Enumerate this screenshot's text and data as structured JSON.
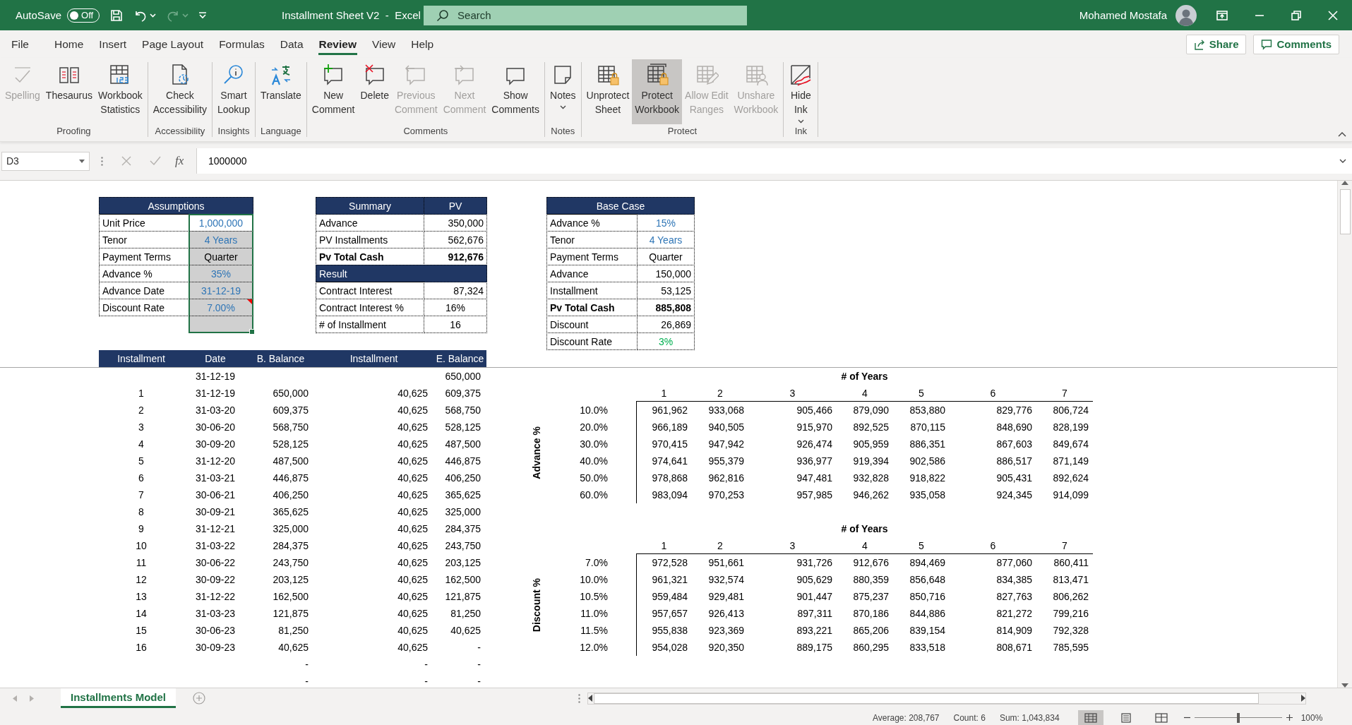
{
  "title_bar": {
    "autosave_label": "AutoSave",
    "autosave": {
      "on": false,
      "label": "Off"
    },
    "title": "Installment Sheet V2  -  Excel",
    "search": {
      "placeholder": "Search"
    },
    "user": "Mohamed Mostafa"
  },
  "tabs": [
    {
      "label": "File",
      "selected": false
    },
    {
      "label": "Home",
      "selected": false
    },
    {
      "label": "Insert",
      "selected": false
    },
    {
      "label": "Page Layout",
      "selected": false
    },
    {
      "label": "Formulas",
      "selected": false
    },
    {
      "label": "Data",
      "selected": false
    },
    {
      "label": "Review",
      "selected": true
    },
    {
      "label": "View",
      "selected": false
    },
    {
      "label": "Help",
      "selected": false
    }
  ],
  "share_button": "Share",
  "comments_button": "Comments",
  "ribbon": {
    "groups": [
      {
        "label": "Proofing",
        "buttons": [
          {
            "label": "Spelling",
            "disabled": true,
            "pressed": false,
            "dropdown": false
          },
          {
            "label": "Thesaurus",
            "disabled": false,
            "pressed": false,
            "dropdown": false
          },
          {
            "label": "Workbook\nStatistics",
            "disabled": false,
            "pressed": false,
            "dropdown": false
          }
        ]
      },
      {
        "label": "Accessibility",
        "buttons": [
          {
            "label": "Check\nAccessibility",
            "disabled": false,
            "pressed": false,
            "dropdown": false
          }
        ]
      },
      {
        "label": "Insights",
        "buttons": [
          {
            "label": "Smart\nLookup",
            "disabled": false,
            "pressed": false,
            "dropdown": false
          }
        ]
      },
      {
        "label": "Language",
        "buttons": [
          {
            "label": "Translate",
            "disabled": false,
            "pressed": false,
            "dropdown": false
          }
        ]
      },
      {
        "label": "Comments",
        "buttons": [
          {
            "label": "New\nComment",
            "disabled": false,
            "pressed": false,
            "dropdown": false
          },
          {
            "label": "Delete",
            "disabled": false,
            "pressed": false,
            "dropdown": false
          },
          {
            "label": "Previous\nComment",
            "disabled": true,
            "pressed": false,
            "dropdown": false
          },
          {
            "label": "Next\nComment",
            "disabled": true,
            "pressed": false,
            "dropdown": false
          },
          {
            "label": "Show\nComments",
            "disabled": false,
            "pressed": false,
            "dropdown": false
          }
        ]
      },
      {
        "label": "Notes",
        "buttons": [
          {
            "label": "Notes",
            "disabled": false,
            "pressed": false,
            "dropdown": true
          }
        ]
      },
      {
        "label": "Protect",
        "buttons": [
          {
            "label": "Unprotect\nSheet",
            "disabled": false,
            "pressed": false,
            "dropdown": false
          },
          {
            "label": "Protect\nWorkbook",
            "disabled": false,
            "pressed": true,
            "dropdown": false
          },
          {
            "label": "Allow Edit\nRanges",
            "disabled": true,
            "pressed": false,
            "dropdown": false
          },
          {
            "label": "Unshare\nWorkbook",
            "disabled": true,
            "pressed": false,
            "dropdown": false
          }
        ]
      },
      {
        "label": "Ink",
        "buttons": [
          {
            "label": "Hide\nInk",
            "disabled": false,
            "pressed": false,
            "dropdown": true
          }
        ]
      }
    ]
  },
  "formula_bar": {
    "name_box": "D3",
    "function_label": "fx",
    "value": "1000000"
  },
  "sheet": {
    "assumptions": {
      "title": "Assumptions",
      "rows": [
        {
          "label": "Unit Price",
          "value": "1,000,000",
          "color": "#2e75b6",
          "shaded": false,
          "selected": true,
          "comment": false
        },
        {
          "label": "Tenor",
          "value": "4 Years",
          "color": "#2e75b6",
          "shaded": true,
          "selected": true,
          "comment": false
        },
        {
          "label": "Payment Terms",
          "value": "Quarter",
          "color": "#000000",
          "shaded": true,
          "selected": true,
          "comment": false
        },
        {
          "label": "Advance %",
          "value": "35%",
          "color": "#2e75b6",
          "shaded": true,
          "selected": true,
          "comment": false
        },
        {
          "label": "Advance Date",
          "value": "31-12-19",
          "color": "#2e75b6",
          "shaded": true,
          "selected": true,
          "comment": false
        },
        {
          "label": "Discount Rate",
          "value": "7.00%",
          "color": "#2e75b6",
          "shaded": true,
          "selected": true,
          "comment": true
        },
        {
          "shaded": true,
          "selected": true,
          "comment": false
        }
      ]
    },
    "summary": {
      "columns": [
        "Summary",
        "PV"
      ],
      "rows": [
        {
          "kind": "amount",
          "label": "Advance",
          "value": "350,000",
          "bold": false
        },
        {
          "kind": "amount",
          "label": "PV Installments",
          "value": "562,676",
          "bold": false
        },
        {
          "kind": "amount",
          "label": "Pv Total Cash",
          "value": "912,676",
          "bold": true
        },
        {
          "kind": "section",
          "label": "Result"
        },
        {
          "kind": "amount",
          "label": "Contract Interest",
          "value": "87,324",
          "bold": false
        },
        {
          "kind": "count",
          "label": "Contract Interest %",
          "value": "16%",
          "bold": false
        },
        {
          "kind": "count",
          "label": "# of Installment",
          "value": "16",
          "bold": false
        }
      ]
    },
    "base_case": {
      "title": "Base Case",
      "rows": [
        {
          "kind": "input",
          "label": "Advance %",
          "value": "15%",
          "color": "#2e75b6",
          "bold": false
        },
        {
          "kind": "input",
          "label": "Tenor",
          "value": "4 Years",
          "color": "#2e75b6",
          "bold": false
        },
        {
          "kind": "input",
          "label": "Payment Terms",
          "value": "Quarter",
          "color": "#000000",
          "bold": false
        },
        {
          "kind": "amount",
          "label": "Advance",
          "value": "150,000",
          "color": "#000000",
          "bold": false
        },
        {
          "kind": "amount",
          "label": "Installment",
          "value": "53,125",
          "color": "#000000",
          "bold": false
        },
        {
          "kind": "amount",
          "label": "Pv Total Cash",
          "value": "885,808",
          "color": "#000000",
          "bold": true
        },
        {
          "kind": "amount",
          "label": "Discount",
          "value": "26,869",
          "color": "#000000",
          "bold": false
        },
        {
          "kind": "input",
          "label": "Discount Rate",
          "value": "3%",
          "color": "#00b050",
          "bold": false
        }
      ]
    },
    "installments": {
      "columns": [
        "Installment",
        "Date",
        "B. Balance",
        "Installment",
        "E. Balance"
      ],
      "opening": {
        "date": "31-12-19",
        "end": "650,000"
      },
      "rows": [
        {
          "n": "1",
          "date": "31-12-19",
          "begin": "650,000",
          "payment": "40,625",
          "end": "609,375"
        },
        {
          "n": "2",
          "date": "31-03-20",
          "begin": "609,375",
          "payment": "40,625",
          "end": "568,750"
        },
        {
          "n": "3",
          "date": "30-06-20",
          "begin": "568,750",
          "payment": "40,625",
          "end": "528,125"
        },
        {
          "n": "4",
          "date": "30-09-20",
          "begin": "528,125",
          "payment": "40,625",
          "end": "487,500"
        },
        {
          "n": "5",
          "date": "31-12-20",
          "begin": "487,500",
          "payment": "40,625",
          "end": "446,875"
        },
        {
          "n": "6",
          "date": "31-03-21",
          "begin": "446,875",
          "payment": "40,625",
          "end": "406,250"
        },
        {
          "n": "7",
          "date": "30-06-21",
          "begin": "406,250",
          "payment": "40,625",
          "end": "365,625"
        },
        {
          "n": "8",
          "date": "30-09-21",
          "begin": "365,625",
          "payment": "40,625",
          "end": "325,000"
        },
        {
          "n": "9",
          "date": "31-12-21",
          "begin": "325,000",
          "payment": "40,625",
          "end": "284,375"
        },
        {
          "n": "10",
          "date": "31-03-22",
          "begin": "284,375",
          "payment": "40,625",
          "end": "243,750"
        },
        {
          "n": "11",
          "date": "30-06-22",
          "begin": "243,750",
          "payment": "40,625",
          "end": "203,125"
        },
        {
          "n": "12",
          "date": "30-09-22",
          "begin": "203,125",
          "payment": "40,625",
          "end": "162,500"
        },
        {
          "n": "13",
          "date": "31-12-22",
          "begin": "162,500",
          "payment": "40,625",
          "end": "121,875"
        },
        {
          "n": "14",
          "date": "31-03-23",
          "begin": "121,875",
          "payment": "40,625",
          "end": "81,250"
        },
        {
          "n": "15",
          "date": "30-06-23",
          "begin": "81,250",
          "payment": "40,625",
          "end": "40,625"
        },
        {
          "n": "16",
          "date": "30-09-23",
          "begin": "40,625",
          "payment": "40,625",
          "end": "-"
        },
        {
          "begin": "-",
          "payment": "-",
          "end": "-"
        },
        {
          "begin": "-",
          "payment": "-",
          "end": "-"
        }
      ]
    },
    "sensitivity": [
      {
        "axis_label": "Advance %",
        "header": "# of Years",
        "columns": [
          "1",
          "2",
          "3",
          "4",
          "5",
          "6",
          "7"
        ],
        "rows": [
          {
            "label": "10.0%",
            "values": [
              "961,962",
              "933,068",
              "905,466",
              "879,090",
              "853,880",
              "829,776",
              "806,724"
            ]
          },
          {
            "label": "20.0%",
            "values": [
              "966,189",
              "940,505",
              "915,970",
              "892,525",
              "870,115",
              "848,690",
              "828,199"
            ]
          },
          {
            "label": "30.0%",
            "values": [
              "970,415",
              "947,942",
              "926,474",
              "905,959",
              "886,351",
              "867,603",
              "849,674"
            ]
          },
          {
            "label": "40.0%",
            "values": [
              "974,641",
              "955,379",
              "936,977",
              "919,394",
              "902,586",
              "886,517",
              "871,149"
            ]
          },
          {
            "label": "50.0%",
            "values": [
              "978,868",
              "962,816",
              "947,481",
              "932,828",
              "918,822",
              "905,431",
              "892,624"
            ]
          },
          {
            "label": "60.0%",
            "values": [
              "983,094",
              "970,253",
              "957,985",
              "946,262",
              "935,058",
              "924,345",
              "914,099"
            ]
          }
        ]
      },
      {
        "axis_label": "Discount %",
        "header": "# of Years",
        "columns": [
          "1",
          "2",
          "3",
          "4",
          "5",
          "6",
          "7"
        ],
        "rows": [
          {
            "label": "7.0%",
            "values": [
              "972,528",
              "951,661",
              "931,726",
              "912,676",
              "894,469",
              "877,060",
              "860,411"
            ]
          },
          {
            "label": "10.0%",
            "values": [
              "961,321",
              "932,574",
              "905,629",
              "880,359",
              "856,648",
              "834,385",
              "813,471"
            ]
          },
          {
            "label": "10.5%",
            "values": [
              "959,484",
              "929,481",
              "901,447",
              "875,237",
              "850,716",
              "827,763",
              "806,262"
            ]
          },
          {
            "label": "11.0%",
            "values": [
              "957,657",
              "926,413",
              "897,311",
              "870,186",
              "844,886",
              "821,272",
              "799,216"
            ]
          },
          {
            "label": "11.5%",
            "values": [
              "955,838",
              "923,369",
              "893,221",
              "865,206",
              "839,154",
              "814,909",
              "792,328"
            ]
          },
          {
            "label": "12.0%",
            "values": [
              "954,028",
              "920,350",
              "889,175",
              "860,295",
              "833,518",
              "808,671",
              "785,595"
            ]
          }
        ]
      }
    ]
  },
  "sheet_tabs": [
    {
      "label": "Installments Model",
      "selected": true
    }
  ],
  "status_bar": {
    "average": "Average: 208,767",
    "count": "Count: 6",
    "sum": "Sum: 1,043,834",
    "views": [
      {
        "selected": true
      },
      {
        "selected": false
      },
      {
        "selected": false
      }
    ],
    "zoom": {
      "level": 0.5,
      "label": "100%"
    }
  }
}
